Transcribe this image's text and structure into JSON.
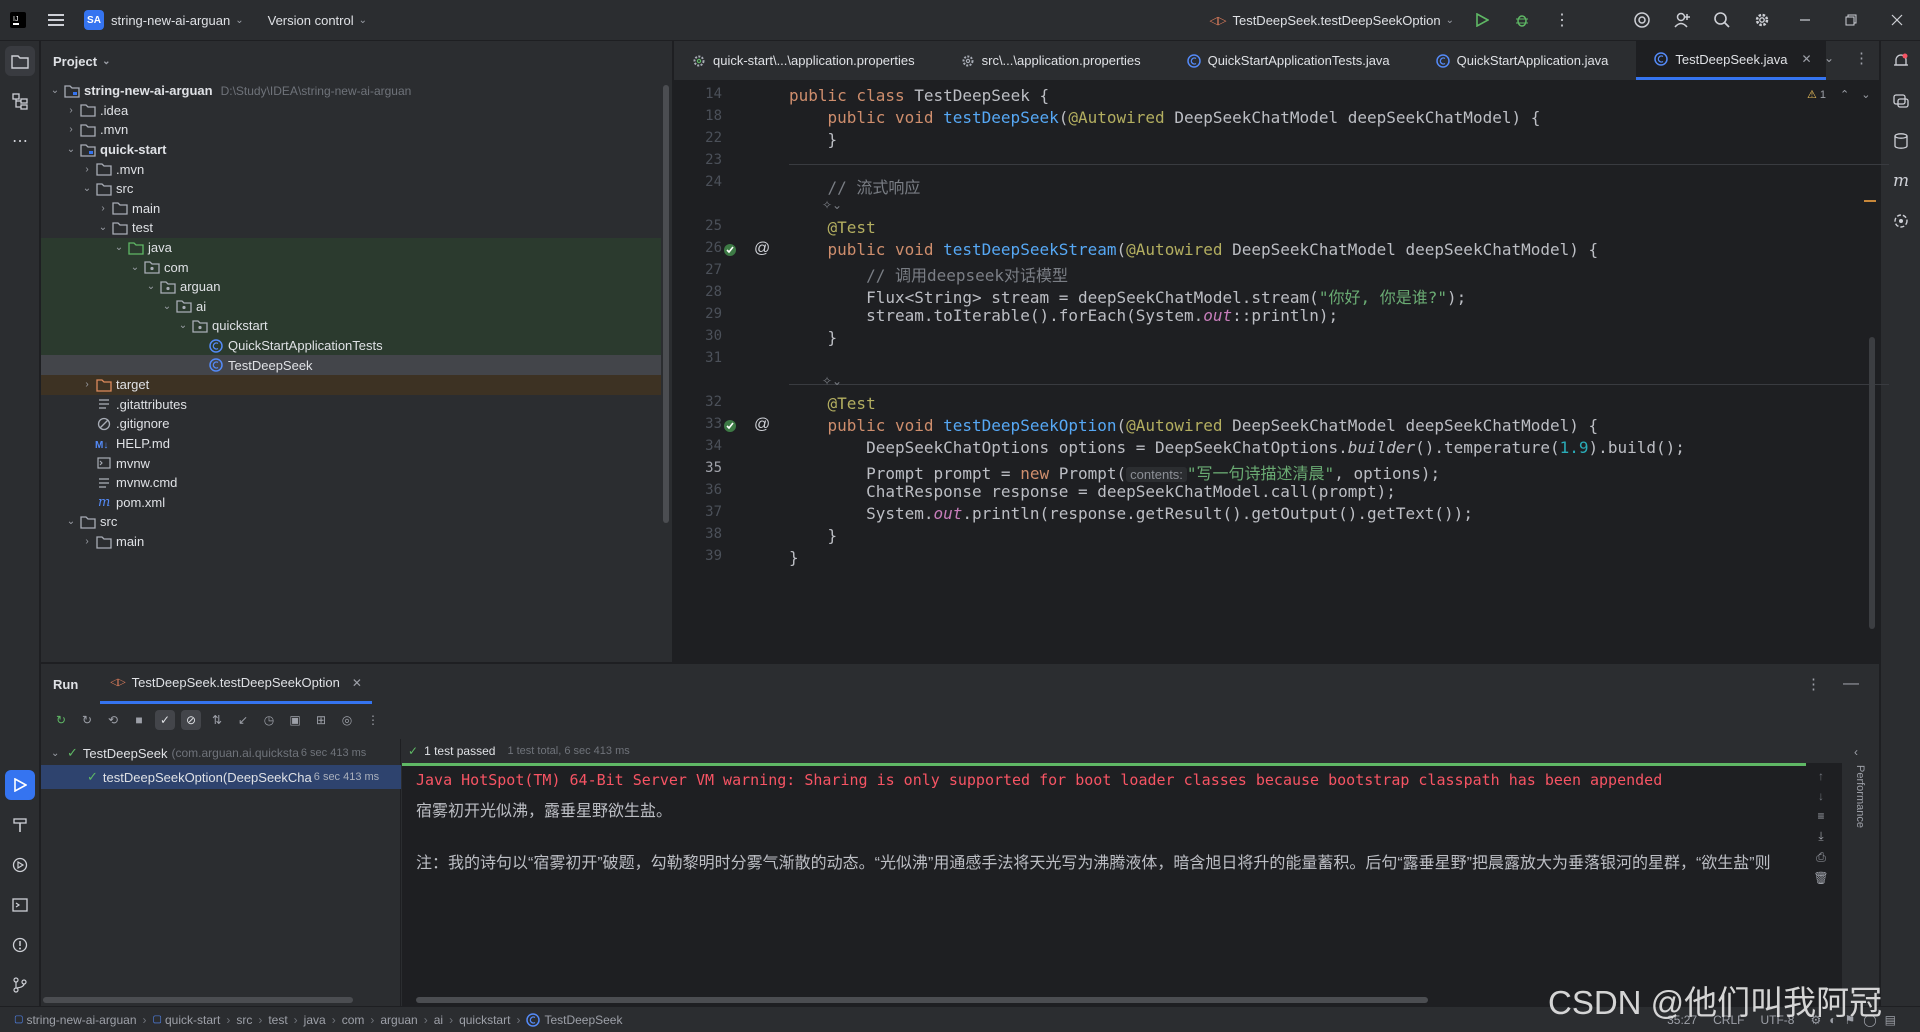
{
  "topbar": {
    "project_badge": "SA",
    "project_name": "string-new-ai-arguan",
    "version_control": "Version control",
    "run_config": "TestDeepSeek.testDeepSeekOption"
  },
  "project_panel": {
    "title": "Project",
    "tree": [
      {
        "label": "string-new-ai-arguan",
        "path": "D:\\Study\\IDEA\\string-new-ai-arguan",
        "icon": "module-folder-icon",
        "level": 0,
        "open": true,
        "bold": true
      },
      {
        "label": ".idea",
        "icon": "folder-icon",
        "level": 1,
        "open": false
      },
      {
        "label": ".mvn",
        "icon": "folder-icon",
        "level": 1,
        "open": false
      },
      {
        "label": "quick-start",
        "icon": "module-folder-icon",
        "level": 1,
        "open": true,
        "bold": true
      },
      {
        "label": ".mvn",
        "icon": "folder-icon",
        "level": 2,
        "open": false
      },
      {
        "label": "src",
        "icon": "folder-icon",
        "level": 2,
        "open": true
      },
      {
        "label": "main",
        "icon": "folder-icon",
        "level": 3,
        "open": false
      },
      {
        "label": "test",
        "icon": "folder-icon",
        "level": 3,
        "open": true
      },
      {
        "label": "java",
        "icon": "test-source-folder-icon",
        "level": 4,
        "open": true,
        "bg": "green"
      },
      {
        "label": "com",
        "icon": "package-icon",
        "level": 5,
        "open": true,
        "bg": "green"
      },
      {
        "label": "arguan",
        "icon": "package-icon",
        "level": 6,
        "open": true,
        "bg": "green"
      },
      {
        "label": "ai",
        "icon": "package-icon",
        "level": 7,
        "open": true,
        "bg": "green"
      },
      {
        "label": "quickstart",
        "icon": "package-icon",
        "level": 8,
        "open": true,
        "bg": "green"
      },
      {
        "label": "QuickStartApplicationTests",
        "icon": "java-class-icon",
        "level": 9,
        "bg": "green"
      },
      {
        "label": "TestDeepSeek",
        "icon": "java-class-icon",
        "level": 9,
        "bg": "selected"
      },
      {
        "label": "target",
        "icon": "excluded-folder-icon",
        "level": 2,
        "open": false,
        "bg": "orange"
      },
      {
        "label": ".gitattributes",
        "icon": "text-file-icon",
        "level": 2
      },
      {
        "label": ".gitignore",
        "icon": "ignore-file-icon",
        "level": 2
      },
      {
        "label": "HELP.md",
        "icon": "markdown-file-icon",
        "level": 2
      },
      {
        "label": "mvnw",
        "icon": "script-file-icon",
        "level": 2
      },
      {
        "label": "mvnw.cmd",
        "icon": "text-file-icon",
        "level": 2
      },
      {
        "label": "pom.xml",
        "icon": "maven-file-icon",
        "level": 2
      },
      {
        "label": "src",
        "icon": "folder-icon",
        "level": 1,
        "open": true
      },
      {
        "label": "main",
        "icon": "folder-icon",
        "level": 2,
        "open": false
      }
    ]
  },
  "editor": {
    "tabs": [
      {
        "label": "quick-start\\...\\application.properties",
        "icon": "properties-icon",
        "active": false
      },
      {
        "label": "src\\...\\application.properties",
        "icon": "gear-icon",
        "active": false
      },
      {
        "label": "QuickStartApplicationTests.java",
        "icon": "java-class-icon",
        "active": false
      },
      {
        "label": "QuickStartApplication.java",
        "icon": "java-class-icon",
        "active": false
      },
      {
        "label": "TestDeepSeek.java",
        "icon": "java-class-icon",
        "active": true
      }
    ],
    "warning_count": "1",
    "inlay_hint": "contents:",
    "line_numbers": [
      "14",
      "18",
      "22",
      "23",
      "24",
      "",
      "25",
      "26",
      "27",
      "28",
      "29",
      "30",
      "31",
      "",
      "32",
      "33",
      "34",
      "35",
      "36",
      "37",
      "38",
      "39"
    ],
    "current_line": "35",
    "lines": {
      "l14_a": "public class ",
      "l14_b": "TestDeepSeek {",
      "l18_a": "    public void ",
      "l18_fn": "testDeepSeek",
      "l18_b": "(",
      "l18_an": "@Autowired",
      "l18_c": " DeepSeekChatModel deepSeekChatModel) {",
      "l22": "    }",
      "l24": "    // 流式响应",
      "l25": "    @Test",
      "l26_a": "    public void ",
      "l26_fn": "testDeepSeekStream",
      "l26_b": "(",
      "l26_an": "@Autowired",
      "l26_c": " DeepSeekChatModel deepSeekChatModel) {",
      "l27": "        // 调用deepseek对话模型",
      "l28_a": "        Flux<String> stream = deepSeekChatModel.stream(",
      "l28_str": "\"你好, 你是谁?\"",
      "l28_b": ");",
      "l29_a": "        stream.toIterable().forEach(System.",
      "l29_st": "out",
      "l29_b": "::println);",
      "l30": "    }",
      "l32": "    @Test",
      "l33_a": "    public void ",
      "l33_fn": "testDeepSeekOption",
      "l33_b": "(",
      "l33_an": "@Autowired",
      "l33_c": " DeepSeekChatModel deepSeekChatModel) {",
      "l34_a": "        DeepSeekChatOptions options = DeepSeekChatOptions.",
      "l34_it": "builder",
      "l34_b": "().temperature(",
      "l34_num": "1.9",
      "l34_c": ").build();",
      "l35_a": "        Prompt prompt = ",
      "l35_k": "new",
      "l35_b": " Prompt(",
      "l35_str": "\"写一句诗描述清晨\"",
      "l35_c": ", options);",
      "l36": "        ChatResponse response = deepSeekChatModel.call(prompt);",
      "l37_a": "        System.",
      "l37_st": "out",
      "l37_b": ".println(response.getResult().getOutput().getText());",
      "l38": "    }",
      "l39": "}"
    }
  },
  "run_panel": {
    "title": "Run",
    "tab": "TestDeepSeek.testDeepSeekOption",
    "tests": [
      {
        "name": "TestDeepSeek",
        "detail": "(com.arguan.ai.quicksta",
        "time": "6 sec 413 ms",
        "status": "passed"
      },
      {
        "name": "testDeepSeekOption(DeepSeekCha",
        "detail": "",
        "time": "6 sec 413 ms",
        "status": "passed"
      }
    ],
    "summary": "1 test passed",
    "summary_detail": "1 test total, 6 sec 413 ms",
    "console": [
      "Java HotSpot(TM) 64-Bit Server VM warning: Sharing is only supported for boot loader classes because bootstrap classpath has been appended",
      "宿雾初开光似沸，露垂星野欲生盐。",
      "",
      "注：我的诗句以“宿雾初开”破题，勾勒黎明时分雾气渐散的动态。“光似沸”用通感手法将天光写为沸腾液体，暗含旭日将升的能量蓄积。后句“露垂星野”把晨露放大为垂落银河的星群，“欲生盐”则"
    ],
    "side_label": "Performance"
  },
  "status_bar": {
    "breadcrumb": [
      "string-new-ai-arguan",
      "quick-start",
      "src",
      "test",
      "java",
      "com",
      "arguan",
      "ai",
      "quickstart",
      "TestDeepSeek"
    ],
    "position": "35:27",
    "line_sep": "CRLF",
    "encoding": "UTF-8",
    "watermark": "CSDN @他们叫我阿冠"
  },
  "colors": {
    "accent": "#3574f0",
    "success": "#5fb865",
    "error_text": "#f75464",
    "warning": "#f2c55c"
  }
}
